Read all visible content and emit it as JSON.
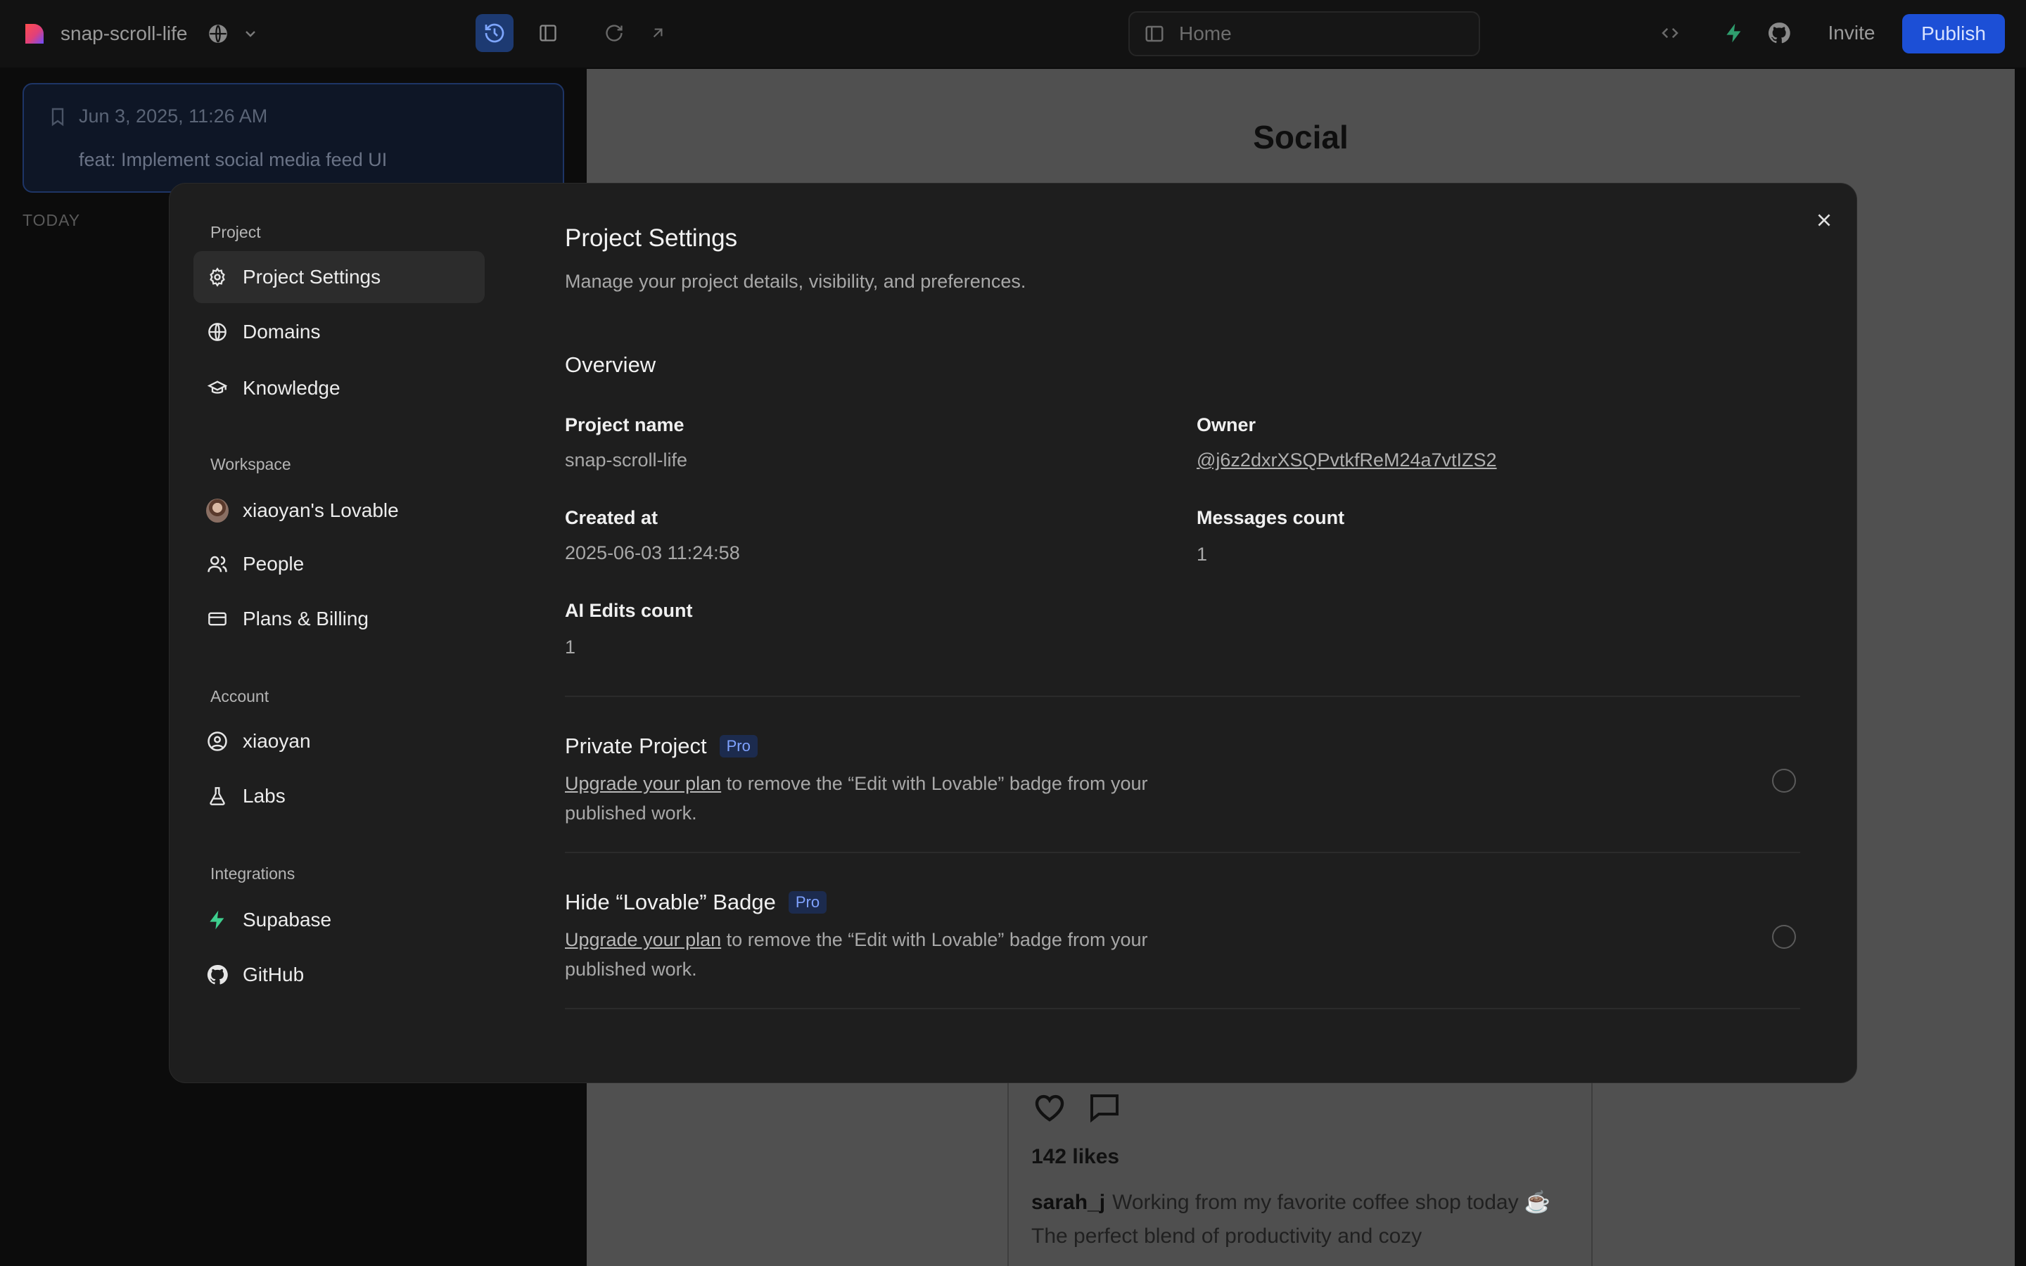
{
  "topbar": {
    "project_name": "snap-scroll-life",
    "url": "Home",
    "invite_label": "Invite",
    "publish_label": "Publish"
  },
  "history": {
    "date": "Jun 3, 2025, 11:26 AM",
    "message": "feat: Implement social media feed UI",
    "section": "TODAY"
  },
  "preview": {
    "title": "Social",
    "likes": "142 likes",
    "username": "sarah_j",
    "caption": "Working from my favorite coffee shop today ☕ The perfect blend of productivity and cozy"
  },
  "modal": {
    "nav": {
      "project_label": "Project",
      "project_items": [
        {
          "label": "Project Settings",
          "icon": "gear-icon"
        },
        {
          "label": "Domains",
          "icon": "globe-icon"
        },
        {
          "label": "Knowledge",
          "icon": "graduation-cap-icon"
        }
      ],
      "workspace_label": "Workspace",
      "workspace_items": [
        {
          "label": "xiaoyan's Lovable",
          "icon": "avatar"
        },
        {
          "label": "People",
          "icon": "users-icon"
        },
        {
          "label": "Plans & Billing",
          "icon": "credit-card-icon"
        }
      ],
      "account_label": "Account",
      "account_items": [
        {
          "label": "xiaoyan",
          "icon": "user-circle-icon"
        },
        {
          "label": "Labs",
          "icon": "flask-icon"
        }
      ],
      "integrations_label": "Integrations",
      "integration_items": [
        {
          "label": "Supabase",
          "icon": "supabase-icon"
        },
        {
          "label": "GitHub",
          "icon": "github-icon"
        }
      ]
    },
    "header": {
      "title": "Project Settings",
      "subtitle": "Manage your project details, visibility, and preferences."
    },
    "overview": {
      "title": "Overview",
      "project_name_label": "Project name",
      "project_name_value": "snap-scroll-life",
      "owner_label": "Owner",
      "owner_value": "@j6z2dxrXSQPvtkfReM24a7vtIZS2",
      "created_label": "Created at",
      "created_value": "2025-06-03 11:24:58",
      "messages_label": "Messages count",
      "messages_value": "1",
      "ai_edits_label": "AI Edits count",
      "ai_edits_value": "1"
    },
    "options": [
      {
        "title": "Private Project",
        "badge": "Pro",
        "link": "Upgrade your plan",
        "desc": "to remove the “Edit with Lovable” badge from your published work.",
        "checked": false
      },
      {
        "title": "Hide “Lovable” Badge",
        "badge": "Pro",
        "link": "Upgrade your plan",
        "desc": "to remove the “Edit with Lovable” badge from your published work.",
        "checked": false
      }
    ]
  },
  "colors": {
    "accent": "#1c4fd6",
    "supabase": "#3ecf8e",
    "modal_bg": "#1e1e1e",
    "page_bg": "#0c0c0c"
  }
}
